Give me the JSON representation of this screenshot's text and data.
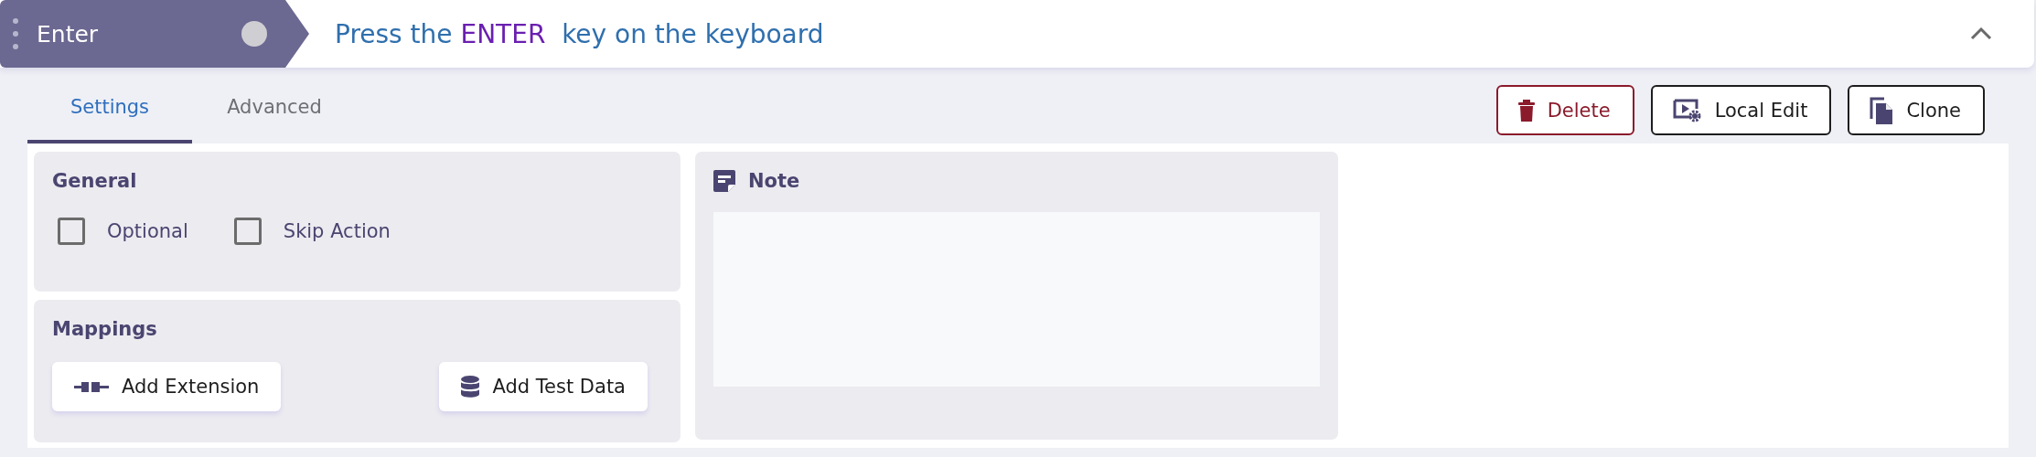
{
  "step": {
    "name": "Enter",
    "description": [
      {
        "text": "Press the",
        "kind": "plain"
      },
      {
        "text": "ENTER",
        "kind": "key"
      },
      {
        "text": "key on the keyboard",
        "kind": "plain"
      }
    ],
    "expanded": true
  },
  "tabs": [
    {
      "label": "Settings",
      "selected": true
    },
    {
      "label": "Advanced",
      "selected": false
    }
  ],
  "actions": [
    {
      "label": "Delete",
      "kind": "delete"
    },
    {
      "label": "Local Edit",
      "kind": "edit"
    },
    {
      "label": "Clone",
      "kind": "clone"
    }
  ],
  "general": {
    "title": "General",
    "options": [
      {
        "label": "Optional",
        "checked": false
      },
      {
        "label": "Skip Action",
        "checked": false
      }
    ]
  },
  "mappings": {
    "title": "Mappings",
    "buttons": [
      {
        "label": "Add Extension",
        "kind": "extension"
      },
      {
        "label": "Add Test Data",
        "kind": "data"
      }
    ]
  },
  "note": {
    "title": "Note"
  }
}
